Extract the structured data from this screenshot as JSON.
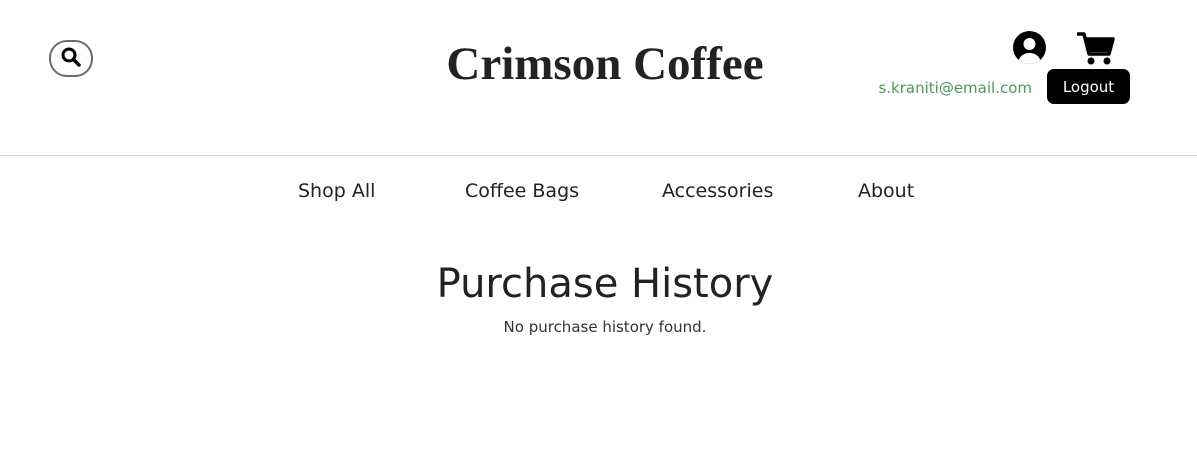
{
  "header": {
    "brand": "Crimson Coffee",
    "user_email": "s.kraniti@email.com",
    "logout_label": "Logout",
    "icons": {
      "search": "search-icon",
      "account": "user-circle-icon",
      "cart": "shopping-cart-icon"
    }
  },
  "nav": {
    "items": [
      {
        "label": "Shop All"
      },
      {
        "label": "Coffee Bags"
      },
      {
        "label": "Accessories"
      },
      {
        "label": "About"
      }
    ]
  },
  "main": {
    "title": "Purchase History",
    "empty_message": "No purchase history found."
  },
  "colors": {
    "email": "#4a9a5a",
    "logout_bg": "#000000",
    "divider": "#dddddd"
  }
}
